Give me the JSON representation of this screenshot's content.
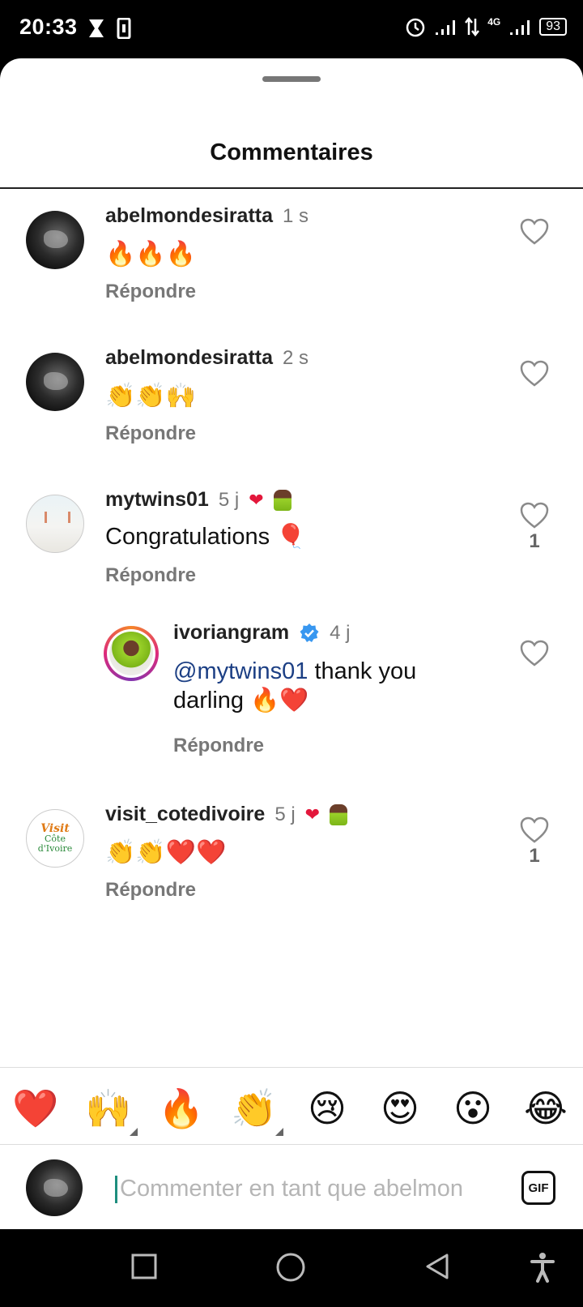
{
  "status_bar": {
    "time": "20:33",
    "network": "4G",
    "battery": "93",
    "icons": [
      "hourglass-icon",
      "phone-icon",
      "alarm-icon",
      "signal-icon",
      "data-arrows-icon",
      "signal-4g-icon",
      "battery-icon"
    ]
  },
  "sheet": {
    "title": "Commentaires"
  },
  "comments": [
    {
      "username": "abelmondesiratta",
      "time": "1 s",
      "text": "🔥🔥🔥",
      "reply": "Répondre",
      "likes": ""
    },
    {
      "username": "abelmondesiratta",
      "time": "2 s",
      "text": "👏👏🙌",
      "reply": "Répondre",
      "likes": ""
    },
    {
      "username": "mytwins01",
      "time": "5 j",
      "text": "Congratulations 🎈",
      "reply": "Répondre",
      "likes": "1"
    },
    {
      "username": "ivoriangram",
      "time": "4 j",
      "mention": "@mytwins01",
      "text_line1": " thank you",
      "text_line2": "darling 🔥❤️",
      "reply": "Répondre",
      "likes": ""
    },
    {
      "username": "visit_cotedivoire",
      "time": "5 j",
      "text": "👏👏❤️❤️",
      "reply": "Répondre",
      "likes": "1"
    }
  ],
  "quick_emojis": [
    "❤️",
    "🙌",
    "🔥",
    "👏",
    "😢",
    "😍",
    "😮",
    "😂"
  ],
  "input": {
    "placeholder": "Commenter en tant que abelmon",
    "gif_label": "GIF"
  },
  "logo": {
    "line1": "Visit",
    "line2": "Côte d'Ivoire"
  },
  "colors": {
    "like_red": "#e3173b",
    "mention_blue": "#1c3f84",
    "verified_blue": "#3897f0",
    "caret_teal": "#1e8e7e"
  }
}
